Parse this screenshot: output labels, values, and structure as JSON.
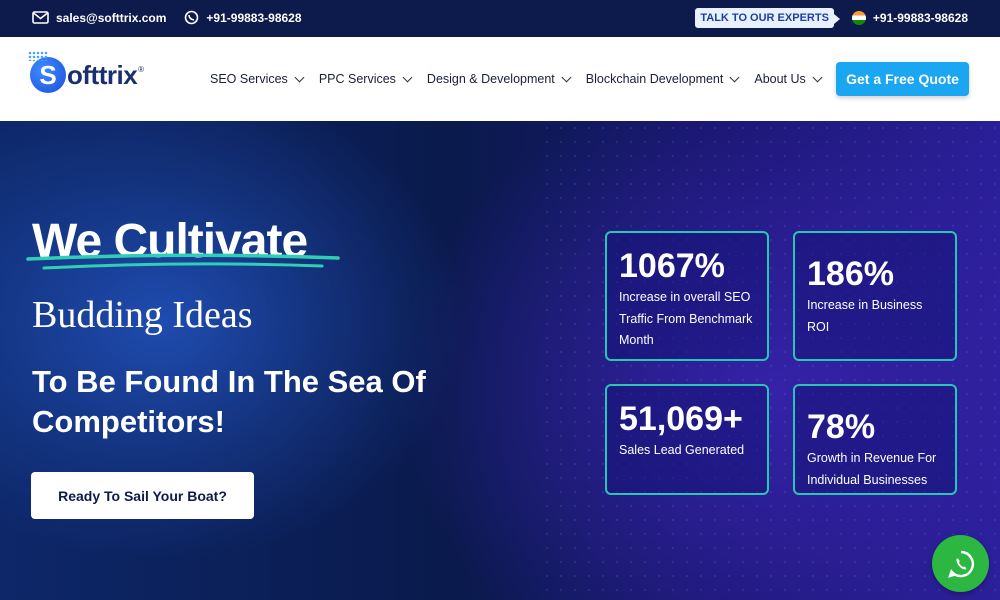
{
  "topbar": {
    "email": "sales@softtrix.com",
    "phone_left": "+91-99883-98628",
    "experts_label": "TALK TO OUR EXPERTS",
    "phone_right": "+91-99883-98628"
  },
  "nav": {
    "logo_text": "ofttrix",
    "logo_letter": "S",
    "logo_reg": "®",
    "menu": [
      "SEO Services",
      "PPC Services",
      "Design & Development",
      "Blockchain Development",
      "About Us"
    ],
    "quote_label": "Get a Free Quote"
  },
  "hero": {
    "title": "We Cultivate",
    "subtitle": "Budding Ideas",
    "line": "To Be Found In The Sea Of Competitors!",
    "cta_label": "Ready To Sail Your Boat?",
    "stats": [
      {
        "value": "1067%",
        "desc": "Increase in overall SEO Traffic From Benchmark Month"
      },
      {
        "value": "186%",
        "desc": "Increase in Business ROI"
      },
      {
        "value": "51,069+",
        "desc": "Sales Lead Generated"
      },
      {
        "value": "78%",
        "desc": "Growth in Revenue For Individual Businesses"
      }
    ]
  },
  "colors": {
    "topbar": "#0d1b4c",
    "accent": "#1aa6f0",
    "stat_border": "#27c7b4",
    "whatsapp": "#2cb742"
  }
}
